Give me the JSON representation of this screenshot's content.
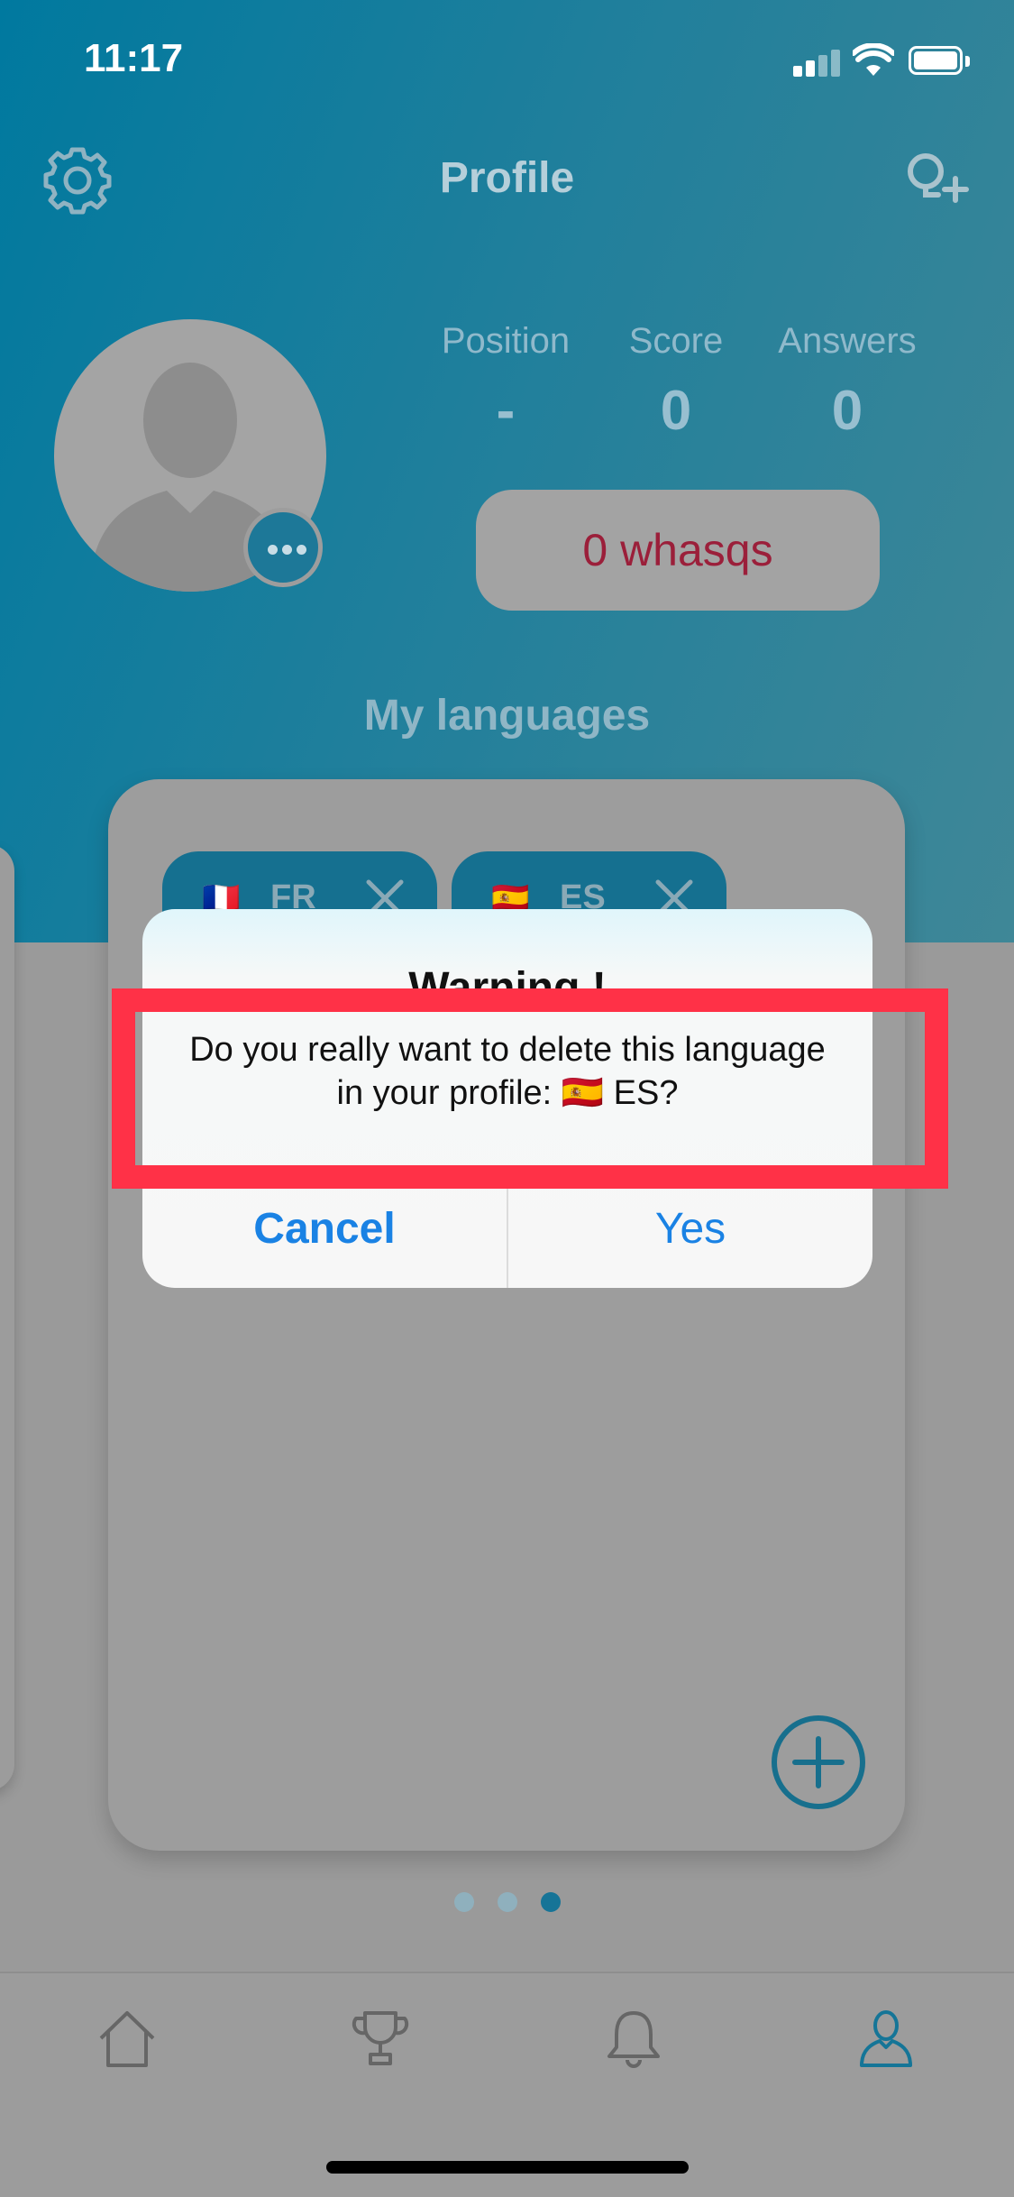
{
  "status": {
    "time": "11:17"
  },
  "nav": {
    "title": "Profile"
  },
  "stats": [
    {
      "label": "Position",
      "value": "-"
    },
    {
      "label": "Score",
      "value": "0"
    },
    {
      "label": "Answers",
      "value": "0"
    }
  ],
  "whasqs": "0 whasqs",
  "section_title": "My languages",
  "languages": [
    {
      "flag": "🇫🇷",
      "code": "FR"
    },
    {
      "flag": "🇪🇸",
      "code": "ES"
    }
  ],
  "pager": {
    "count": 3,
    "active": 2
  },
  "dialog": {
    "title": "Warning !",
    "message": "Do you really want to delete this language in your profile: 🇪🇸 ES?",
    "cancel": "Cancel",
    "confirm": "Yes"
  },
  "colors": {
    "accent": "#1a82e4",
    "highlight": "#ff3147",
    "header": "#00799f",
    "whasqs_text": "#9b1f3a"
  },
  "icons": {
    "settings": "gear-icon",
    "add_friend": "add-user-icon",
    "tabs": [
      "home-icon",
      "trophy-icon",
      "bell-icon",
      "profile-icon"
    ]
  }
}
